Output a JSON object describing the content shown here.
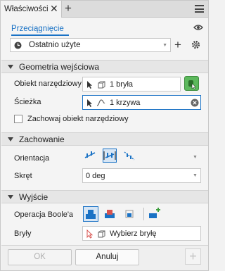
{
  "tab": {
    "title": "Właściwości"
  },
  "header": {
    "drag_link": "Przeciągnięcie"
  },
  "recent": {
    "label": "Ostatnio użyte"
  },
  "sections": {
    "geometry": "Geometria wejściowa",
    "behavior": "Zachowanie",
    "output": "Wyjście"
  },
  "geometry": {
    "tool_body_label": "Obiekt narzędziowy",
    "tool_body_value": "1 bryła",
    "path_label": "Ścieżka",
    "path_value": "1 krzywa",
    "keep_tool_label": "Zachowaj obiekt narzędziowy"
  },
  "behavior": {
    "orientation_label": "Orientacja",
    "twist_label": "Skręt",
    "twist_value": "0 deg"
  },
  "output": {
    "boolean_label": "Operacja Boole'a",
    "bodies_label": "Bryły",
    "bodies_value": "Wybierz bryłę"
  },
  "buttons": {
    "ok": "OK",
    "cancel": "Anuluj"
  },
  "colors": {
    "accent": "#1a72c5",
    "green": "#5cb85c",
    "red": "#d9534f"
  }
}
